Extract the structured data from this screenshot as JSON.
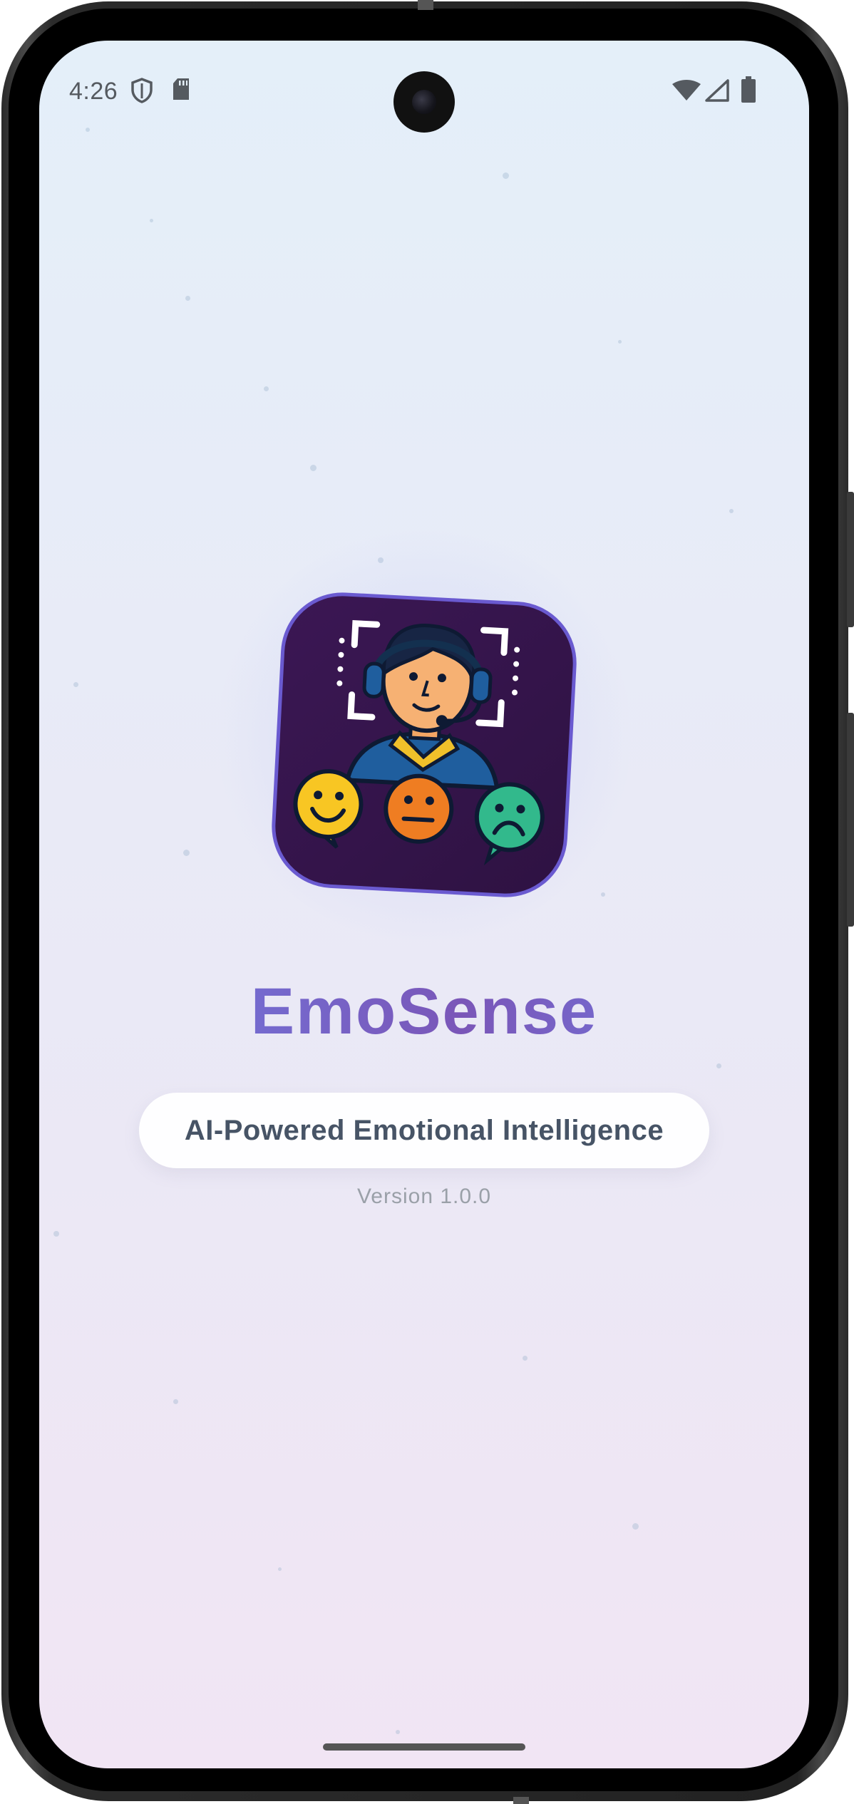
{
  "status_bar": {
    "time": "4:26",
    "icons_left": [
      "shield-icon",
      "sd-card-icon"
    ],
    "icons_right": [
      "wifi-icon",
      "signal-icon",
      "battery-icon"
    ]
  },
  "splash": {
    "app_name": "EmoSense",
    "tagline": "AI-Powered Emotional Intelligence",
    "version": "Version 1.0.0",
    "logo_icon": "emotion-agent-logo-icon"
  },
  "colors": {
    "background_top": "#e4eff9",
    "background_bottom": "#f1e5f4",
    "brand_gradient_start": "#6f7fe6",
    "brand_gradient_mid": "#7a56b8",
    "logo_background": "#3a1752",
    "tagline_text": "#475466",
    "version_text": "#9aa0a8"
  }
}
